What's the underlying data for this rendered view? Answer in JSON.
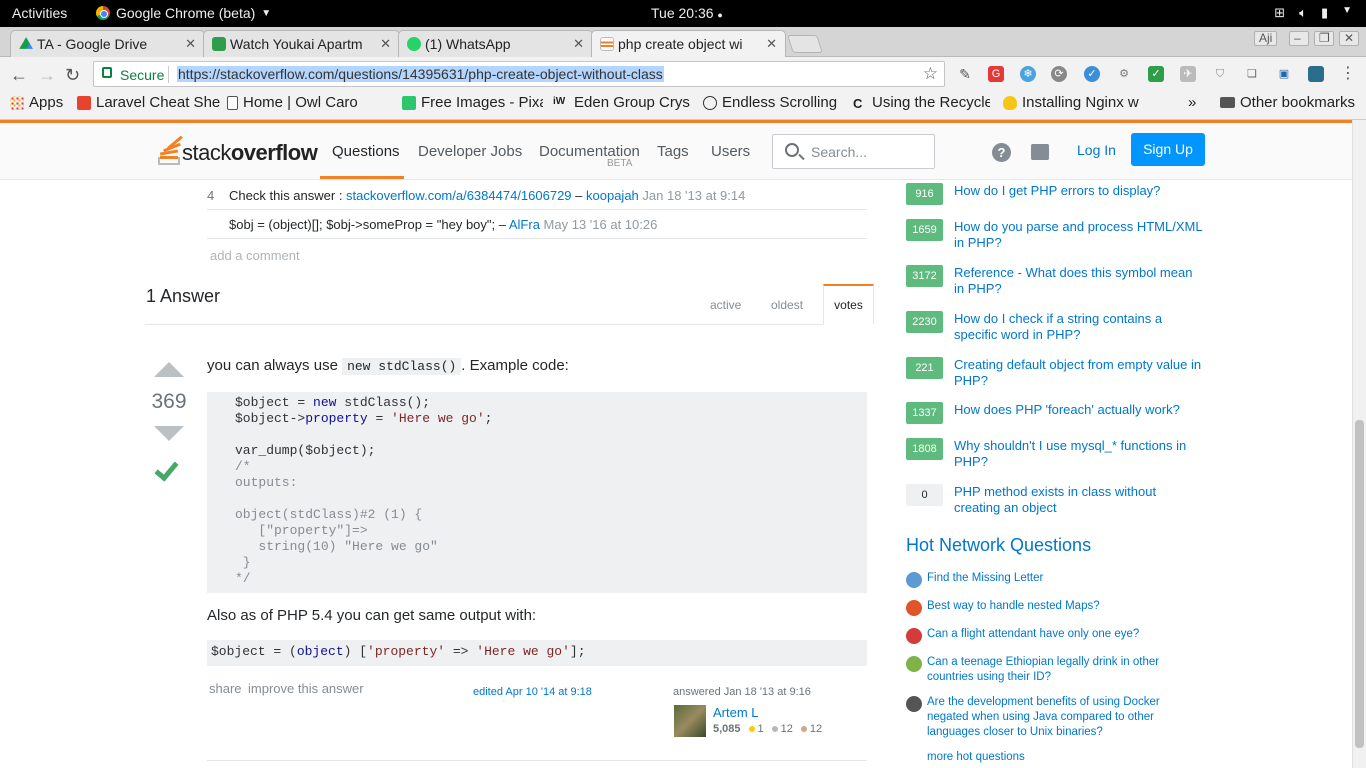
{
  "os": {
    "activities": "Activities",
    "app_name": "Google Chrome (beta)",
    "clock": "Tue 20:36"
  },
  "browser": {
    "tabs": [
      {
        "title": "TA - Google Drive",
        "icon": "google-drive-icon"
      },
      {
        "title": "Watch Youkai Apartm",
        "icon": "tv-icon"
      },
      {
        "title": "(1) WhatsApp",
        "icon": "whatsapp-icon"
      },
      {
        "title": "php create object wi",
        "icon": "stackoverflow-icon",
        "active": true
      }
    ],
    "profile": "Aji",
    "secure_label": "Secure",
    "url": "https://stackoverflow.com/questions/14395631/php-create-object-without-class",
    "extension_badge": "4",
    "bookmarks": [
      {
        "label": "Apps",
        "icon": "apps-grid-icon"
      },
      {
        "label": "Laravel Cheat She",
        "icon": "laravel-icon"
      },
      {
        "label": "Home | Owl Caro",
        "icon": "page-icon"
      },
      {
        "label": "Free Images - Pixa",
        "icon": "pixabay-icon"
      },
      {
        "label": "Eden Group Cryst",
        "icon": "iw-icon"
      },
      {
        "label": "Endless Scrolling",
        "icon": "check-circle-icon"
      },
      {
        "label": "Using the Recycle",
        "icon": "c-icon"
      },
      {
        "label": "Installing Nginx w",
        "icon": "lightbulb-icon"
      }
    ],
    "bookmarks_more": "»",
    "other_bookmarks": "Other bookmarks"
  },
  "so_header": {
    "logo_light": "stack",
    "logo_bold": "overflow",
    "nav": [
      "Questions",
      "Developer Jobs",
      "Documentation",
      "Tags",
      "Users"
    ],
    "doc_badge": "BETA",
    "search_placeholder": "Search...",
    "login": "Log In",
    "signup": "Sign Up"
  },
  "comments": [
    {
      "score": "4",
      "text": "Check this answer : ",
      "link": "stackoverflow.com/a/6384474/1606729",
      "sep": " – ",
      "user": "koopajah",
      "date": " Jan 18 '13 at 9:14"
    },
    {
      "score": "",
      "text": "$obj = (object)[]; $obj->someProp = \"hey boy\"; ",
      "link": "",
      "sep": "– ",
      "user": "AlFra",
      "date": " May 13 '16 at 10:26"
    }
  ],
  "add_comment": "add a comment",
  "answers_header": "1 Answer",
  "sort_tabs": [
    "active",
    "oldest",
    "votes"
  ],
  "answer": {
    "score": "369",
    "intro_before": "you can always use ",
    "intro_code": "new stdClass()",
    "intro_after": ". Example code:",
    "also_text": "Also as of PHP 5.4 you can get same output with:",
    "share": "share",
    "improve": "improve this answer",
    "edited": "edited Apr 10 '14 at 9:18",
    "answered": "answered Jan 18 '13 at 9:16",
    "user": "Artem L",
    "rep": "5,085",
    "gold": "1",
    "silver": "12",
    "bronze": "12"
  },
  "related": [
    {
      "votes": "916",
      "title": "How do I get PHP errors to display?"
    },
    {
      "votes": "1659",
      "title": "How do you parse and process HTML/XML in PHP?"
    },
    {
      "votes": "3172",
      "title": "Reference - What does this symbol mean in PHP?"
    },
    {
      "votes": "2230",
      "title": "How do I check if a string contains a specific word in PHP?"
    },
    {
      "votes": "221",
      "title": "Creating default object from empty value in PHP?"
    },
    {
      "votes": "1337",
      "title": "How does PHP 'foreach' actually work?"
    },
    {
      "votes": "1808",
      "title": "Why shouldn't I use mysql_* functions in PHP?"
    },
    {
      "votes": "0",
      "title": "PHP method exists in class without creating an object"
    }
  ],
  "hot": {
    "title": "Hot Network Questions",
    "items": [
      {
        "icon": "codegolf-icon",
        "color": "#5d9ad4",
        "title": "Find the Missing Letter"
      },
      {
        "icon": "softwareengineering-icon",
        "color": "#e0542a",
        "title": "Best way to handle nested Maps?"
      },
      {
        "icon": "aviation-icon",
        "color": "#d43b3b",
        "title": "Can a flight attendant have only one eye?"
      },
      {
        "icon": "travel-icon",
        "color": "#7fb347",
        "title": "Can a teenage Ethiopian legally drink in other countries using their ID?"
      },
      {
        "icon": "softwarerecs-icon",
        "color": "#555555",
        "title": "Are the development benefits of using Docker negated when using Java compared to other languages closer to Unix binaries?"
      }
    ],
    "more": "more hot questions"
  }
}
